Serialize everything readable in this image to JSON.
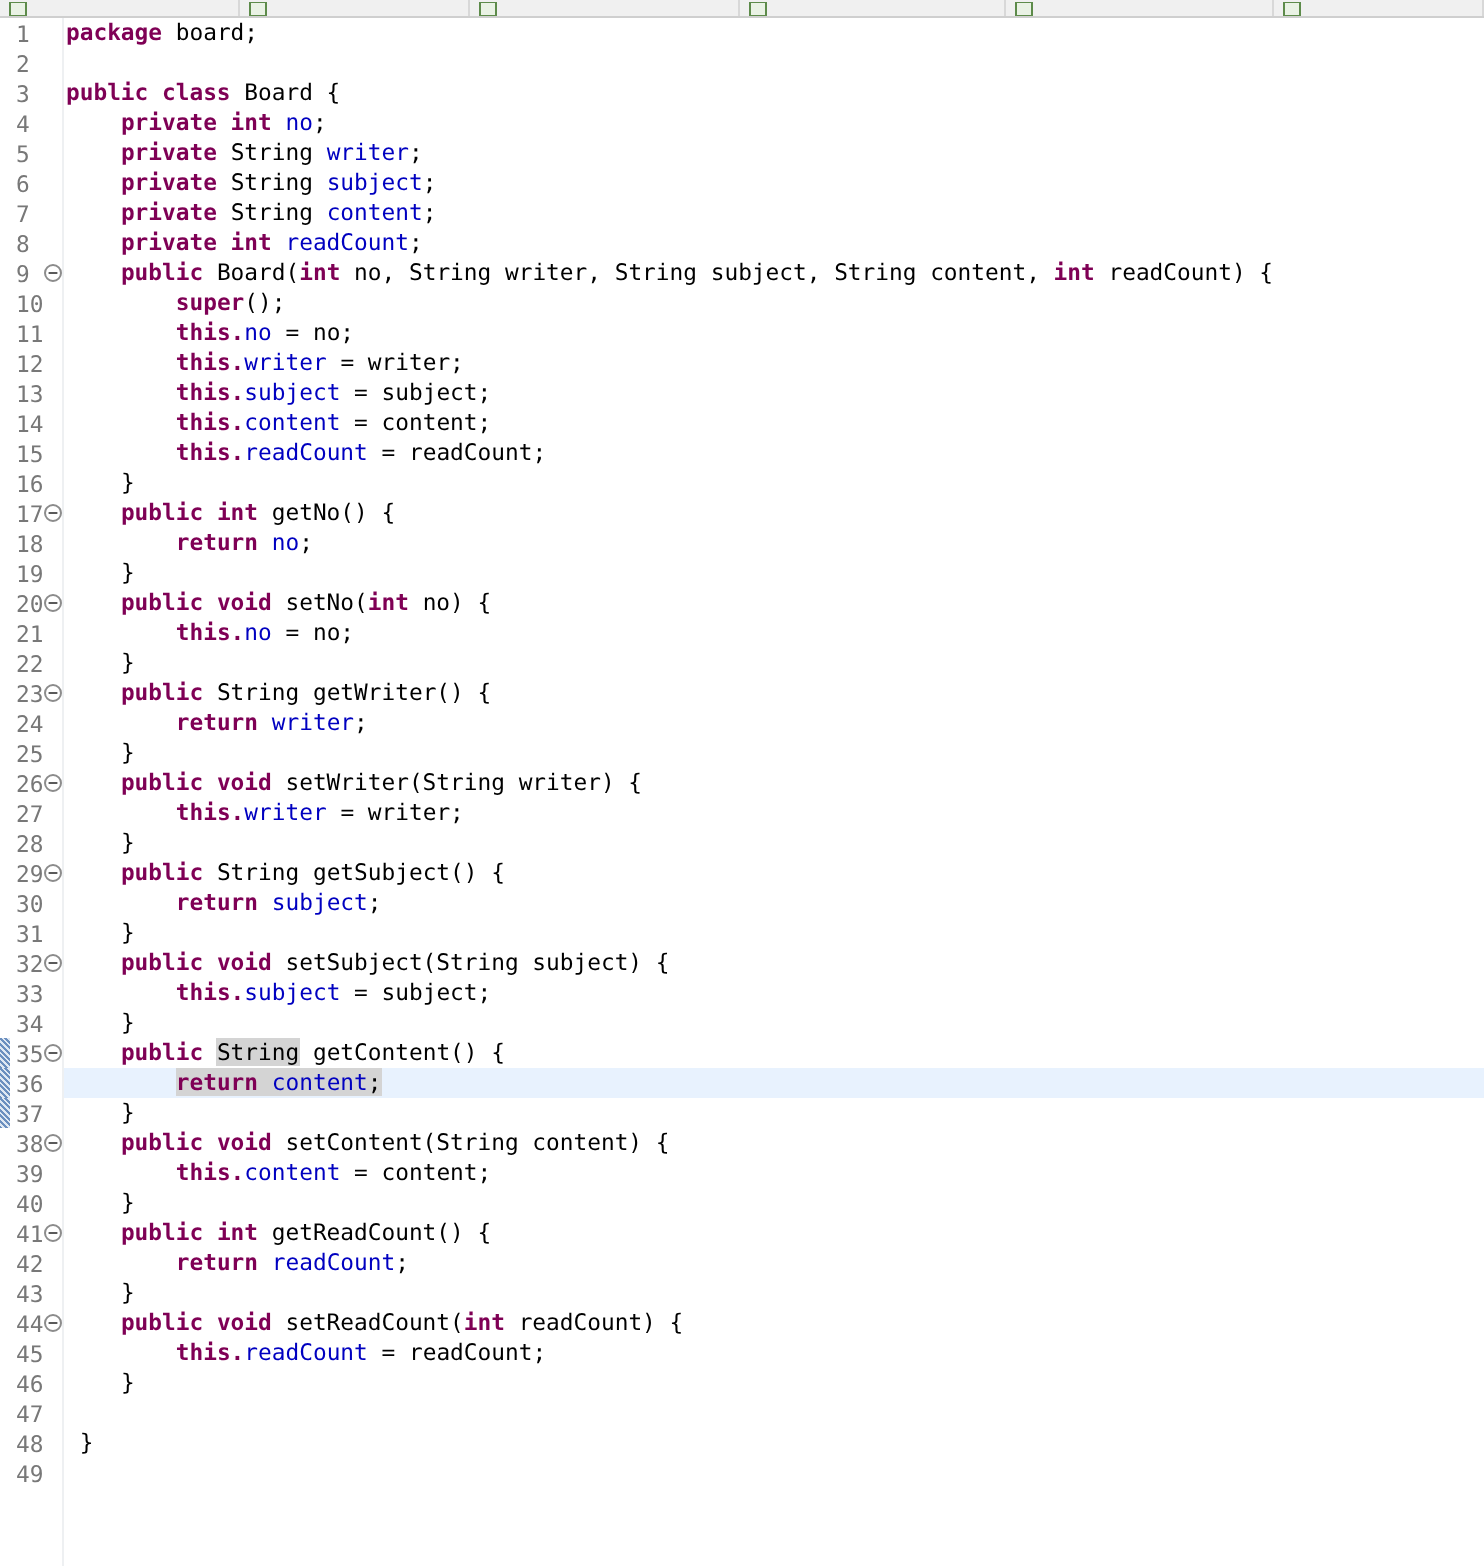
{
  "editor": {
    "lines": [
      {
        "no": "1",
        "fold": false,
        "current": false,
        "changed": false,
        "tokens": [
          {
            "kind": "kw",
            "t": "package"
          },
          {
            "kind": "p",
            "t": " board;"
          }
        ]
      },
      {
        "no": "2",
        "fold": false,
        "current": false,
        "changed": false
      },
      {
        "no": "3",
        "fold": false,
        "current": false,
        "changed": false,
        "tokens": [
          {
            "kind": "kw",
            "t": "public class"
          },
          {
            "kind": "p",
            "t": " Board {"
          }
        ]
      },
      {
        "no": "4",
        "fold": false,
        "current": false,
        "changed": false,
        "tokens": [
          {
            "kind": "kw",
            "t": "    private int "
          },
          {
            "kind": "f",
            "t": "no"
          },
          {
            "kind": "p",
            "t": ";"
          }
        ]
      },
      {
        "no": "5",
        "fold": false,
        "current": false,
        "changed": false,
        "tokens": [
          {
            "kind": "kw",
            "t": "    private"
          },
          {
            "kind": "p",
            "t": " String "
          },
          {
            "kind": "f",
            "t": "writer"
          },
          {
            "kind": "p",
            "t": ";"
          }
        ]
      },
      {
        "no": "6",
        "fold": false,
        "current": false,
        "changed": false,
        "tokens": [
          {
            "kind": "kw",
            "t": "    private"
          },
          {
            "kind": "p",
            "t": " String "
          },
          {
            "kind": "f",
            "t": "subject"
          },
          {
            "kind": "p",
            "t": ";"
          }
        ]
      },
      {
        "no": "7",
        "fold": false,
        "current": false,
        "changed": false,
        "tokens": [
          {
            "kind": "kw",
            "t": "    private"
          },
          {
            "kind": "p",
            "t": " String "
          },
          {
            "kind": "f",
            "t": "content"
          },
          {
            "kind": "p",
            "t": ";"
          }
        ]
      },
      {
        "no": "8",
        "fold": false,
        "current": false,
        "changed": false,
        "tokens": [
          {
            "kind": "kw",
            "t": "    private int "
          },
          {
            "kind": "f",
            "t": "readCount"
          },
          {
            "kind": "p",
            "t": ";"
          }
        ]
      },
      {
        "no": "9",
        "fold": true,
        "current": false,
        "changed": false,
        "tokens": [
          {
            "kind": "kw",
            "t": "    public"
          },
          {
            "kind": "p",
            "t": " Board("
          },
          {
            "kind": "kw",
            "t": "int"
          },
          {
            "kind": "p",
            "t": " no, String writer, String subject, String content, "
          },
          {
            "kind": "kw",
            "t": "int"
          },
          {
            "kind": "p",
            "t": " readCount) {"
          }
        ]
      },
      {
        "no": "10",
        "fold": false,
        "current": false,
        "changed": false,
        "tokens": [
          {
            "kind": "kw",
            "t": "        super"
          },
          {
            "kind": "p",
            "t": "();"
          }
        ]
      },
      {
        "no": "11",
        "fold": false,
        "current": false,
        "changed": false,
        "tokens": [
          {
            "kind": "kw",
            "t": "        this."
          },
          {
            "kind": "f",
            "t": "no"
          },
          {
            "kind": "p",
            "t": " = no;"
          }
        ]
      },
      {
        "no": "12",
        "fold": false,
        "current": false,
        "changed": false,
        "tokens": [
          {
            "kind": "kw",
            "t": "        this."
          },
          {
            "kind": "f",
            "t": "writer"
          },
          {
            "kind": "p",
            "t": " = writer;"
          }
        ]
      },
      {
        "no": "13",
        "fold": false,
        "current": false,
        "changed": false,
        "tokens": [
          {
            "kind": "kw",
            "t": "        this."
          },
          {
            "kind": "f",
            "t": "subject"
          },
          {
            "kind": "p",
            "t": " = subject;"
          }
        ]
      },
      {
        "no": "14",
        "fold": false,
        "current": false,
        "changed": false,
        "tokens": [
          {
            "kind": "kw",
            "t": "        this."
          },
          {
            "kind": "f",
            "t": "content"
          },
          {
            "kind": "p",
            "t": " = content;"
          }
        ]
      },
      {
        "no": "15",
        "fold": false,
        "current": false,
        "changed": false,
        "tokens": [
          {
            "kind": "kw",
            "t": "        this."
          },
          {
            "kind": "f",
            "t": "readCount"
          },
          {
            "kind": "p",
            "t": " = readCount;"
          }
        ]
      },
      {
        "no": "16",
        "fold": false,
        "current": false,
        "changed": false,
        "tokens": [
          {
            "kind": "p",
            "t": "    }"
          }
        ]
      },
      {
        "no": "17",
        "fold": true,
        "current": false,
        "changed": false,
        "tokens": [
          {
            "kind": "kw",
            "t": "    public int"
          },
          {
            "kind": "p",
            "t": " getNo() {"
          }
        ]
      },
      {
        "no": "18",
        "fold": false,
        "current": false,
        "changed": false,
        "tokens": [
          {
            "kind": "kw",
            "t": "        return "
          },
          {
            "kind": "f",
            "t": "no"
          },
          {
            "kind": "p",
            "t": ";"
          }
        ]
      },
      {
        "no": "19",
        "fold": false,
        "current": false,
        "changed": false,
        "tokens": [
          {
            "kind": "p",
            "t": "    }"
          }
        ]
      },
      {
        "no": "20",
        "fold": true,
        "current": false,
        "changed": false,
        "tokens": [
          {
            "kind": "kw",
            "t": "    public void"
          },
          {
            "kind": "p",
            "t": " setNo("
          },
          {
            "kind": "kw",
            "t": "int"
          },
          {
            "kind": "p",
            "t": " no) {"
          }
        ]
      },
      {
        "no": "21",
        "fold": false,
        "current": false,
        "changed": false,
        "tokens": [
          {
            "kind": "kw",
            "t": "        this."
          },
          {
            "kind": "f",
            "t": "no"
          },
          {
            "kind": "p",
            "t": " = no;"
          }
        ]
      },
      {
        "no": "22",
        "fold": false,
        "current": false,
        "changed": false,
        "tokens": [
          {
            "kind": "p",
            "t": "    }"
          }
        ]
      },
      {
        "no": "23",
        "fold": true,
        "current": false,
        "changed": false,
        "tokens": [
          {
            "kind": "kw",
            "t": "    public"
          },
          {
            "kind": "p",
            "t": " String getWriter() {"
          }
        ]
      },
      {
        "no": "24",
        "fold": false,
        "current": false,
        "changed": false,
        "tokens": [
          {
            "kind": "kw",
            "t": "        return "
          },
          {
            "kind": "f",
            "t": "writer"
          },
          {
            "kind": "p",
            "t": ";"
          }
        ]
      },
      {
        "no": "25",
        "fold": false,
        "current": false,
        "changed": false,
        "tokens": [
          {
            "kind": "p",
            "t": "    }"
          }
        ]
      },
      {
        "no": "26",
        "fold": true,
        "current": false,
        "changed": false,
        "tokens": [
          {
            "kind": "kw",
            "t": "    public void"
          },
          {
            "kind": "p",
            "t": " setWriter(String writer) {"
          }
        ]
      },
      {
        "no": "27",
        "fold": false,
        "current": false,
        "changed": false,
        "tokens": [
          {
            "kind": "kw",
            "t": "        this."
          },
          {
            "kind": "f",
            "t": "writer"
          },
          {
            "kind": "p",
            "t": " = writer;"
          }
        ]
      },
      {
        "no": "28",
        "fold": false,
        "current": false,
        "changed": false,
        "tokens": [
          {
            "kind": "p",
            "t": "    }"
          }
        ]
      },
      {
        "no": "29",
        "fold": true,
        "current": false,
        "changed": false,
        "tokens": [
          {
            "kind": "kw",
            "t": "    public"
          },
          {
            "kind": "p",
            "t": " String getSubject() {"
          }
        ]
      },
      {
        "no": "30",
        "fold": false,
        "current": false,
        "changed": false,
        "tokens": [
          {
            "kind": "kw",
            "t": "        return "
          },
          {
            "kind": "f",
            "t": "subject"
          },
          {
            "kind": "p",
            "t": ";"
          }
        ]
      },
      {
        "no": "31",
        "fold": false,
        "current": false,
        "changed": false,
        "tokens": [
          {
            "kind": "p",
            "t": "    }"
          }
        ]
      },
      {
        "no": "32",
        "fold": true,
        "current": false,
        "changed": false,
        "tokens": [
          {
            "kind": "kw",
            "t": "    public void"
          },
          {
            "kind": "p",
            "t": " setSubject(String subject) {"
          }
        ]
      },
      {
        "no": "33",
        "fold": false,
        "current": false,
        "changed": false,
        "tokens": [
          {
            "kind": "kw",
            "t": "        this."
          },
          {
            "kind": "f",
            "t": "subject"
          },
          {
            "kind": "p",
            "t": " = subject;"
          }
        ]
      },
      {
        "no": "34",
        "fold": false,
        "current": false,
        "changed": false,
        "tokens": [
          {
            "kind": "p",
            "t": "    }"
          }
        ]
      },
      {
        "no": "35",
        "fold": true,
        "current": false,
        "changed": true,
        "tokens": [
          {
            "kind": "kw",
            "t": "    public "
          },
          {
            "kind": "p",
            "t": "String",
            "marked": true
          },
          {
            "kind": "p",
            "t": " getContent() {"
          }
        ]
      },
      {
        "no": "36",
        "fold": false,
        "current": true,
        "changed": true,
        "tokens": [
          {
            "kind": "kw",
            "t": "        return ",
            "marked": true
          },
          {
            "kind": "f",
            "t": "content",
            "marked": true
          },
          {
            "kind": "p",
            "t": ";",
            "marked": true
          }
        ]
      },
      {
        "no": "37",
        "fold": false,
        "current": false,
        "changed": true,
        "tokens": [
          {
            "kind": "p",
            "t": "    }"
          }
        ]
      },
      {
        "no": "38",
        "fold": true,
        "current": false,
        "changed": false,
        "tokens": [
          {
            "kind": "kw",
            "t": "    public void"
          },
          {
            "kind": "p",
            "t": " setContent(String content) {"
          }
        ]
      },
      {
        "no": "39",
        "fold": false,
        "current": false,
        "changed": false,
        "tokens": [
          {
            "kind": "kw",
            "t": "        this."
          },
          {
            "kind": "f",
            "t": "content"
          },
          {
            "kind": "p",
            "t": " = content;"
          }
        ]
      },
      {
        "no": "40",
        "fold": false,
        "current": false,
        "changed": false,
        "tokens": [
          {
            "kind": "p",
            "t": "    }"
          }
        ]
      },
      {
        "no": "41",
        "fold": true,
        "current": false,
        "changed": false,
        "tokens": [
          {
            "kind": "kw",
            "t": "    public int"
          },
          {
            "kind": "p",
            "t": " getReadCount() {"
          }
        ]
      },
      {
        "no": "42",
        "fold": false,
        "current": false,
        "changed": false,
        "tokens": [
          {
            "kind": "kw",
            "t": "        return "
          },
          {
            "kind": "f",
            "t": "readCount"
          },
          {
            "kind": "p",
            "t": ";"
          }
        ]
      },
      {
        "no": "43",
        "fold": false,
        "current": false,
        "changed": false,
        "tokens": [
          {
            "kind": "p",
            "t": "    }"
          }
        ]
      },
      {
        "no": "44",
        "fold": true,
        "current": false,
        "changed": false,
        "tokens": [
          {
            "kind": "kw",
            "t": "    public void"
          },
          {
            "kind": "p",
            "t": " setReadCount("
          },
          {
            "kind": "kw",
            "t": "int"
          },
          {
            "kind": "p",
            "t": " readCount) {"
          }
        ]
      },
      {
        "no": "45",
        "fold": false,
        "current": false,
        "changed": false,
        "tokens": [
          {
            "kind": "kw",
            "t": "        this."
          },
          {
            "kind": "f",
            "t": "readCount"
          },
          {
            "kind": "p",
            "t": " = readCount;"
          }
        ]
      },
      {
        "no": "46",
        "fold": false,
        "current": false,
        "changed": false,
        "tokens": [
          {
            "kind": "p",
            "t": "    }"
          }
        ]
      },
      {
        "no": "47",
        "fold": false,
        "current": false,
        "changed": false
      },
      {
        "no": "48",
        "fold": false,
        "current": false,
        "changed": false,
        "tokens": [
          {
            "kind": "p",
            "t": " }"
          }
        ]
      },
      {
        "no": "49",
        "fold": false,
        "current": false,
        "changed": false
      }
    ]
  }
}
